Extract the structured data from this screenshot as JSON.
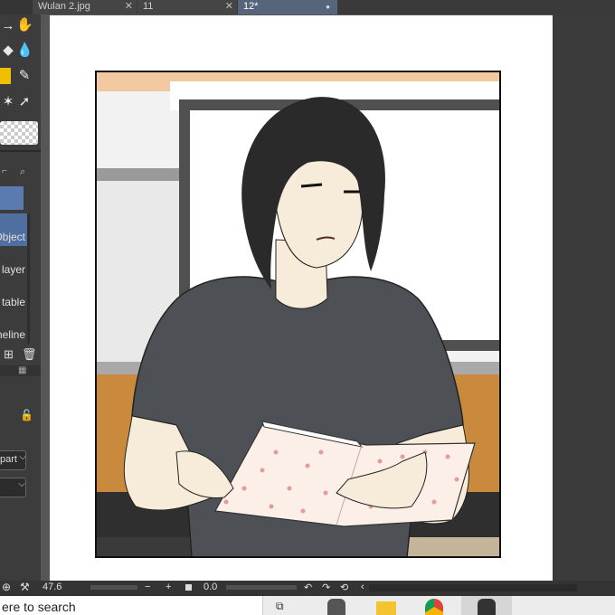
{
  "tabs": [
    {
      "label": "Wulan 2.jpg",
      "close": "✕"
    },
    {
      "label": "11",
      "close": "✕"
    },
    {
      "label": "12*",
      "close": "●"
    }
  ],
  "left_panel": {
    "labels": [
      "Object",
      "layer",
      "table",
      "meline"
    ],
    "dropdown1": "part",
    "dropdown_arrow": "⌵"
  },
  "status": {
    "zoom": "47.6",
    "minus": "−",
    "plus": "+",
    "angle": "0.0"
  },
  "taskbar": {
    "search_text": "ere to search"
  },
  "colors": {
    "accent_selected": "#4f6fa0",
    "tab_active": "#56647c",
    "shirt": "#4d5055",
    "wood": "#c98a3e"
  }
}
